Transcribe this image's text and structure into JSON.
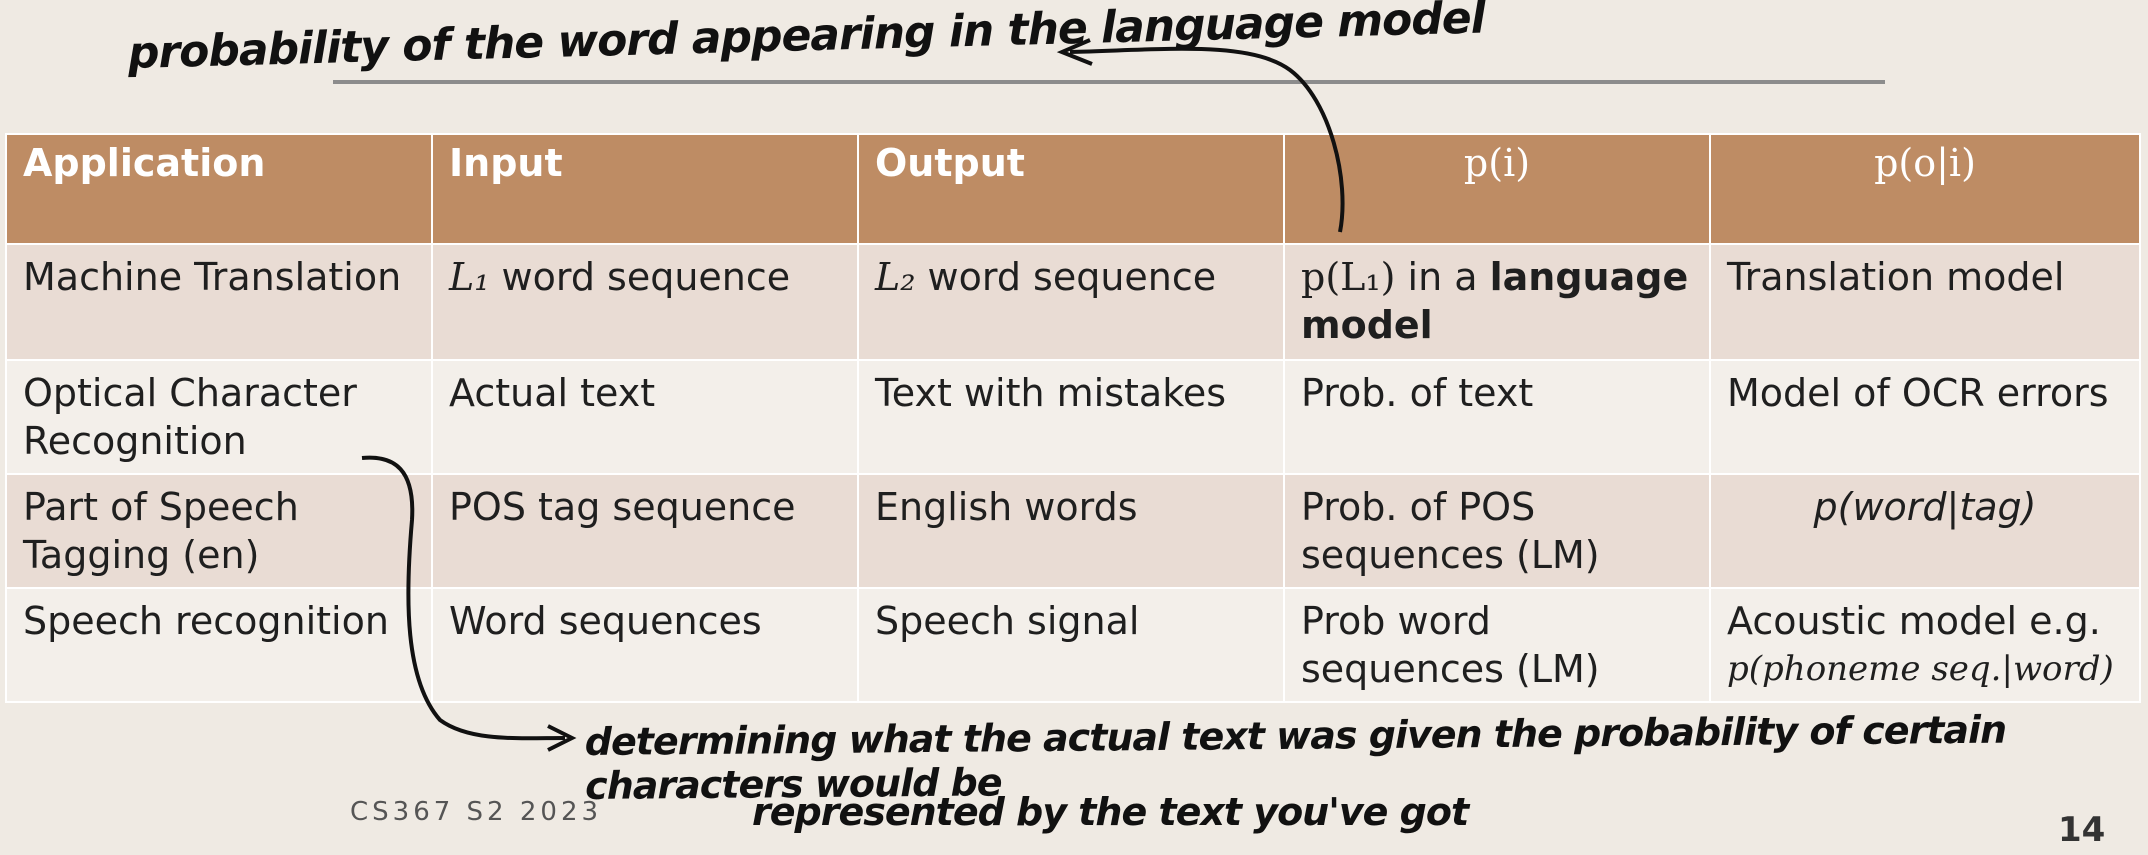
{
  "annotations": {
    "top": "probability of the word appearing in the language model",
    "bottom_line1": "determining what the actual text was given the probability of certain characters would be",
    "bottom_line2": "represented by the text you've got"
  },
  "table": {
    "headers": {
      "application": "Application",
      "input": "Input",
      "output": "Output",
      "p_i": "p(i)",
      "p_o_given_i": "p(o|i)"
    },
    "rows": [
      {
        "application": "Machine Translation",
        "input_var": "L₁",
        "input_rest": " word sequence",
        "output_var": "L₂",
        "output_rest": " word sequence",
        "p_i_math": "p(L₁)",
        "p_i_mid": " in a ",
        "p_i_bold": "language model",
        "p_o_i": "Translation model"
      },
      {
        "application": "Optical Character Recognition",
        "input": "Actual text",
        "output": "Text with mistakes",
        "p_i": "Prob. of text",
        "p_o_i": "Model of OCR errors"
      },
      {
        "application": "Part of Speech Tagging (en)",
        "input": "POS tag sequence",
        "output": "English words",
        "p_i": "Prob. of POS sequences (LM)",
        "p_o_i_math": "p(word|tag)"
      },
      {
        "application": "Speech recognition",
        "input": "Word sequences",
        "output": "Speech signal",
        "p_i": "Prob word sequences (LM)",
        "p_o_i_text": "Acoustic model e.g.",
        "p_o_i_math": "p(phoneme seq.|word)"
      }
    ]
  },
  "footer": {
    "course": "CS367 S2 2023",
    "page": "14"
  },
  "colors": {
    "header_bg": "#be8c64",
    "row_dark": "#e9dcd4",
    "row_light": "#f3efea",
    "background": "#efeae3"
  }
}
